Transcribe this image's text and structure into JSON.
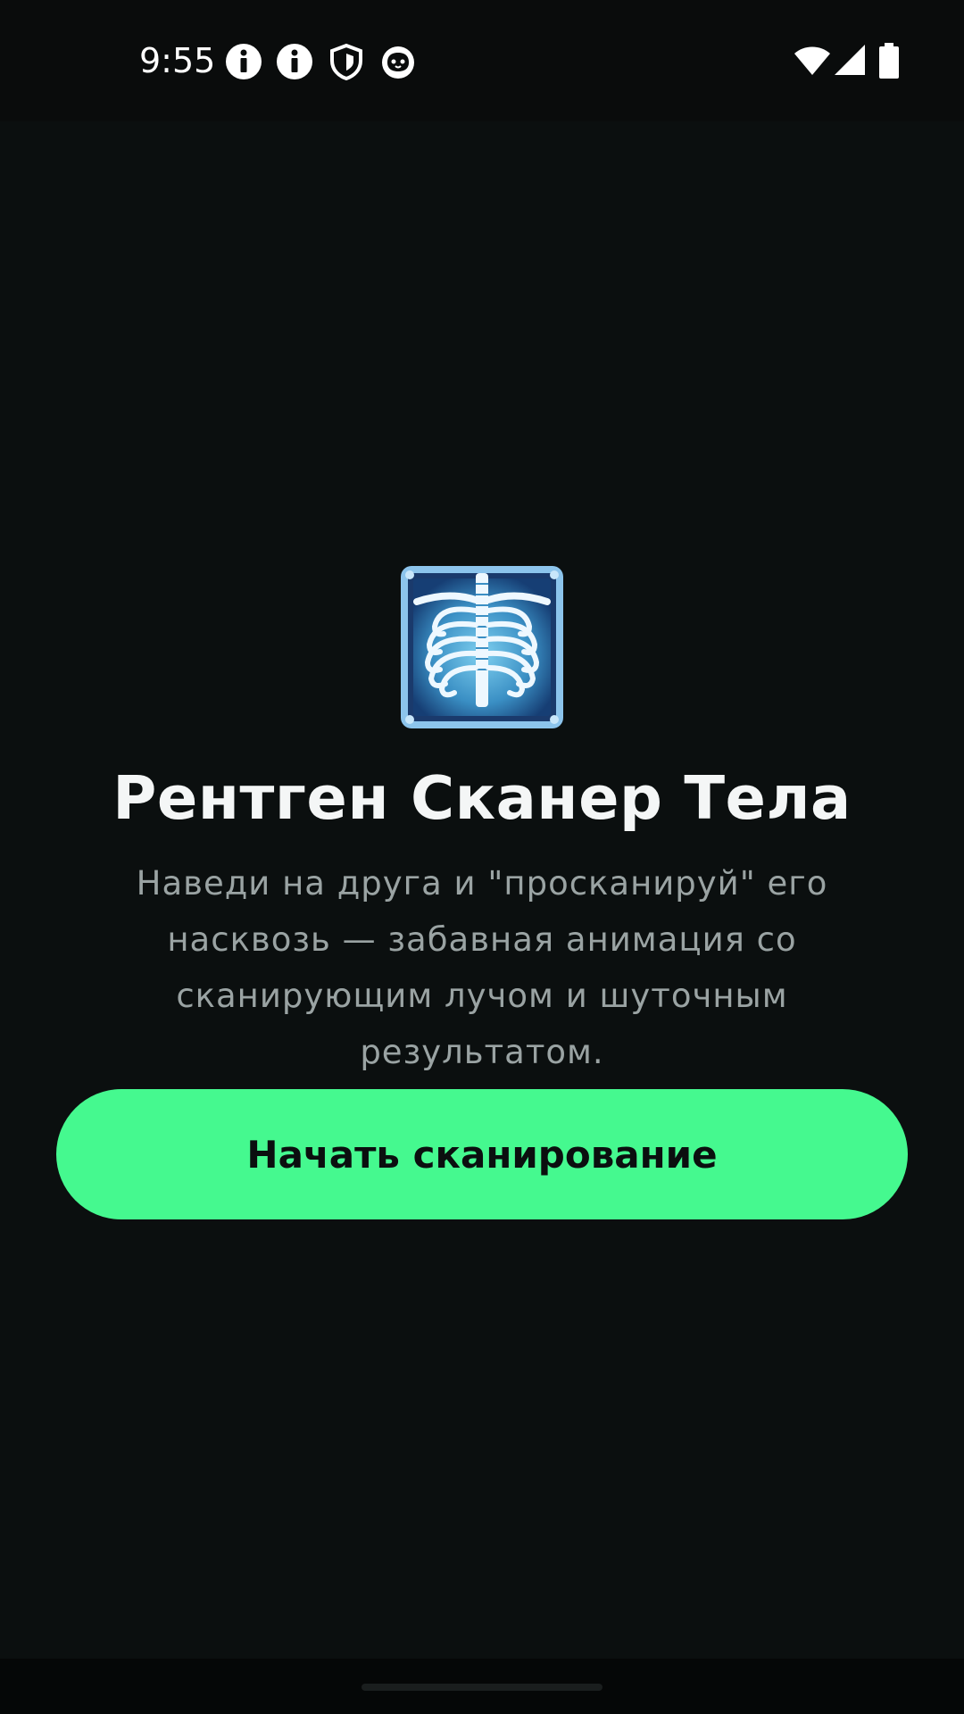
{
  "status_bar": {
    "time": "9:55",
    "left_icons": [
      "info-icon",
      "info-icon",
      "shield-icon",
      "cat-face-icon"
    ],
    "right_icons": [
      "wifi-icon",
      "cellular-signal-icon",
      "battery-icon"
    ]
  },
  "main": {
    "app_icon": "xray-chest-icon",
    "title": "Рентген Сканер Тела",
    "description": "Наведи на друга и \"просканируй\" его насквозь — забавная анимация со сканирующим лучом и шуточным результатом.",
    "start_button_label": "Начать сканирование"
  },
  "colors": {
    "background": "#0b0f0f",
    "accent": "#45f98f",
    "title": "#f4f6f6",
    "description": "#9aa3a3"
  }
}
